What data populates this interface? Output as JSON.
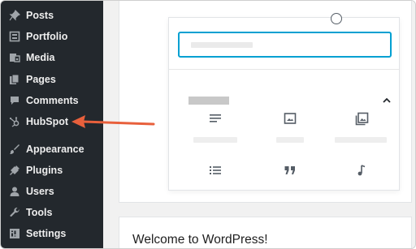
{
  "sidebar": {
    "items": [
      {
        "label": "Posts",
        "icon": "pin-icon"
      },
      {
        "label": "Portfolio",
        "icon": "portfolio-icon"
      },
      {
        "label": "Media",
        "icon": "media-icon"
      },
      {
        "label": "Pages",
        "icon": "pages-icon"
      },
      {
        "label": "Comments",
        "icon": "comments-icon"
      },
      {
        "label": "HubSpot",
        "icon": "hubspot-icon"
      },
      {
        "label": "Appearance",
        "icon": "paintbrush-icon"
      },
      {
        "label": "Plugins",
        "icon": "plugin-icon"
      },
      {
        "label": "Users",
        "icon": "users-icon"
      },
      {
        "label": "Tools",
        "icon": "wrench-icon"
      },
      {
        "label": "Settings",
        "icon": "settings-icon"
      }
    ]
  },
  "annotation": {
    "arrow_color": "#e8603c",
    "points_to": "HubSpot"
  },
  "editor": {
    "welcome_text": "Welcome to WordPress!",
    "accent_color": "#00a0d2",
    "blocks": [
      {
        "icon": "paragraph-icon"
      },
      {
        "icon": "image-icon"
      },
      {
        "icon": "gallery-icon"
      },
      {
        "icon": "list-icon"
      },
      {
        "icon": "quote-icon"
      },
      {
        "icon": "audio-icon"
      }
    ]
  }
}
